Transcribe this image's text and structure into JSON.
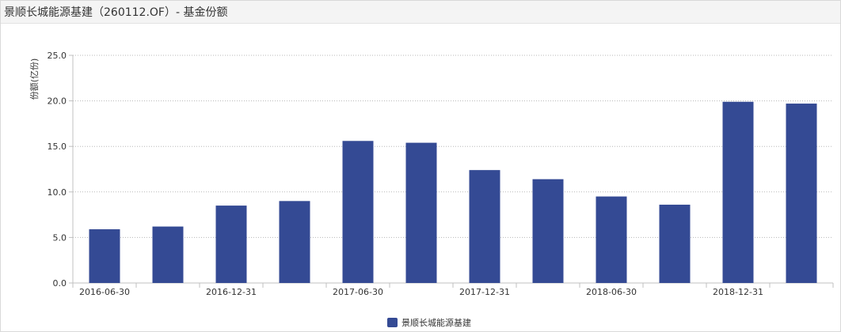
{
  "header": {
    "title": "景顺长城能源基建（260112.OF）- 基金份额"
  },
  "chart_data": {
    "type": "bar",
    "title": "",
    "xlabel": "",
    "ylabel": "份额(亿份)",
    "ylim": [
      0,
      25
    ],
    "yticks": [
      "0.0",
      "5.0",
      "10.0",
      "15.0",
      "20.0",
      "25.0"
    ],
    "grid": true,
    "legend_position": "bottom-center",
    "categories": [
      "2016-06-30",
      "2016-09-30",
      "2016-12-31",
      "2017-03-31",
      "2017-06-30",
      "2017-09-30",
      "2017-12-31",
      "2018-03-31",
      "2018-06-30",
      "2018-09-30",
      "2018-12-31",
      "2019-03-31"
    ],
    "xtick_labels": [
      "2016-06-30",
      "",
      "2016-12-31",
      "",
      "2017-06-30",
      "",
      "2017-12-31",
      "",
      "2018-06-30",
      "",
      "2018-12-31",
      ""
    ],
    "series": [
      {
        "name": "景顺长城能源基建",
        "color": "#344a94",
        "values": [
          5.9,
          6.2,
          8.5,
          9.0,
          15.6,
          15.4,
          12.4,
          11.4,
          9.5,
          8.6,
          19.9,
          19.7
        ]
      }
    ]
  }
}
